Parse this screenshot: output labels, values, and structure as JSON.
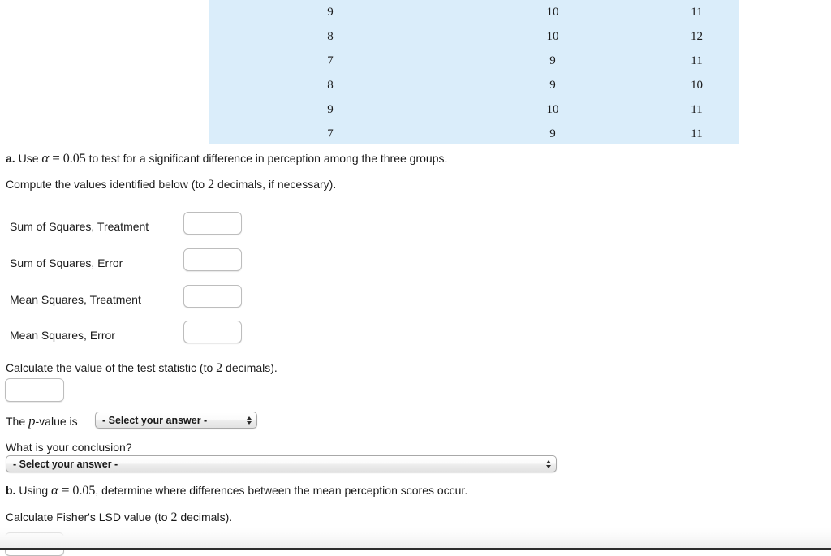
{
  "table": {
    "background_color": "#daedfa",
    "columns": 3,
    "rows": [
      [
        "9",
        "10",
        "11"
      ],
      [
        "8",
        "10",
        "12"
      ],
      [
        "7",
        "9",
        "11"
      ],
      [
        "8",
        "9",
        "10"
      ],
      [
        "9",
        "10",
        "11"
      ],
      [
        "7",
        "9",
        "11"
      ]
    ]
  },
  "part_a": {
    "marker": "a.",
    "prompt_pre": "Use",
    "alpha_symbol": "α",
    "equals": "=",
    "alpha_value": "0.05",
    "prompt_post": "to test for a significant difference in perception among the three groups.",
    "instruction_pre": "Compute the values identified below (to",
    "decimals": "2",
    "instruction_post": "decimals, if necessary)."
  },
  "fields": [
    {
      "label": "Sum of Squares, Treatment",
      "value": "",
      "placeholder": ""
    },
    {
      "label": "Sum of Squares, Error",
      "value": "",
      "placeholder": ""
    },
    {
      "label": "Mean Squares, Treatment",
      "value": "",
      "placeholder": ""
    },
    {
      "label": "Mean Squares, Error",
      "value": "",
      "placeholder": ""
    }
  ],
  "test_statistic": {
    "prompt_pre": "Calculate the value of the test statistic (to",
    "decimals": "2",
    "prompt_post": "decimals).",
    "value": "",
    "placeholder": ""
  },
  "p_value": {
    "label_pre": "The",
    "p_symbol": "p",
    "label_post": "-value is",
    "selected": "- Select your answer -"
  },
  "conclusion": {
    "question": "What is your conclusion?",
    "selected": "- Select your answer -"
  },
  "part_b": {
    "marker": "b.",
    "prompt_pre": "Using",
    "alpha_symbol": "α",
    "equals": "=",
    "alpha_value": "0.05",
    "prompt_post": ", determine where differences between the mean perception scores occur.",
    "lsd_pre": "Calculate Fisher's LSD value (to",
    "decimals": "2",
    "lsd_post": "decimals).",
    "lsd_value": "",
    "lsd_placeholder": ""
  }
}
